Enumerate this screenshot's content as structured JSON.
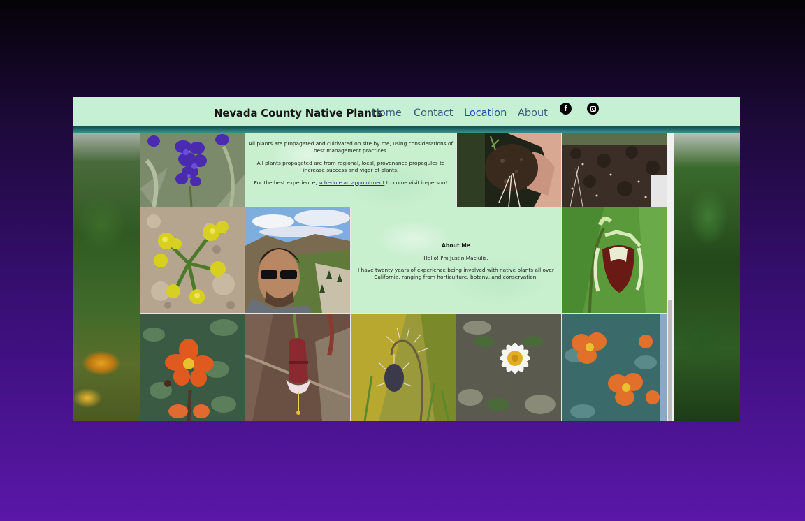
{
  "nav": {
    "brand": "Nevada County Native Plants",
    "links": [
      "Home",
      "Contact",
      "Location",
      "About"
    ],
    "social": [
      "facebook-icon",
      "instagram-icon"
    ]
  },
  "intro": {
    "line1": "All plants are propagated and cultivated on site by me, using considerations of best management practices.",
    "line2": "All plants propagated are from regional, local, provenance propagules to increase success and vigor of plants.",
    "line3_pre": "For the best experience, ",
    "line3_link": "schedule an appointment",
    "line3_post": " to come visit in-person!"
  },
  "about": {
    "heading": "About Me",
    "greeting": "Hello! I'm Justin Maciulis.",
    "bio": "I have twenty years of experience being involved with native plants all over California, ranging from horticulture, botany, and conservation."
  },
  "colors": {
    "nav_bg": "#c6f0d3",
    "active_link": "#1d4fa6",
    "text_panel": "#c8efce"
  }
}
